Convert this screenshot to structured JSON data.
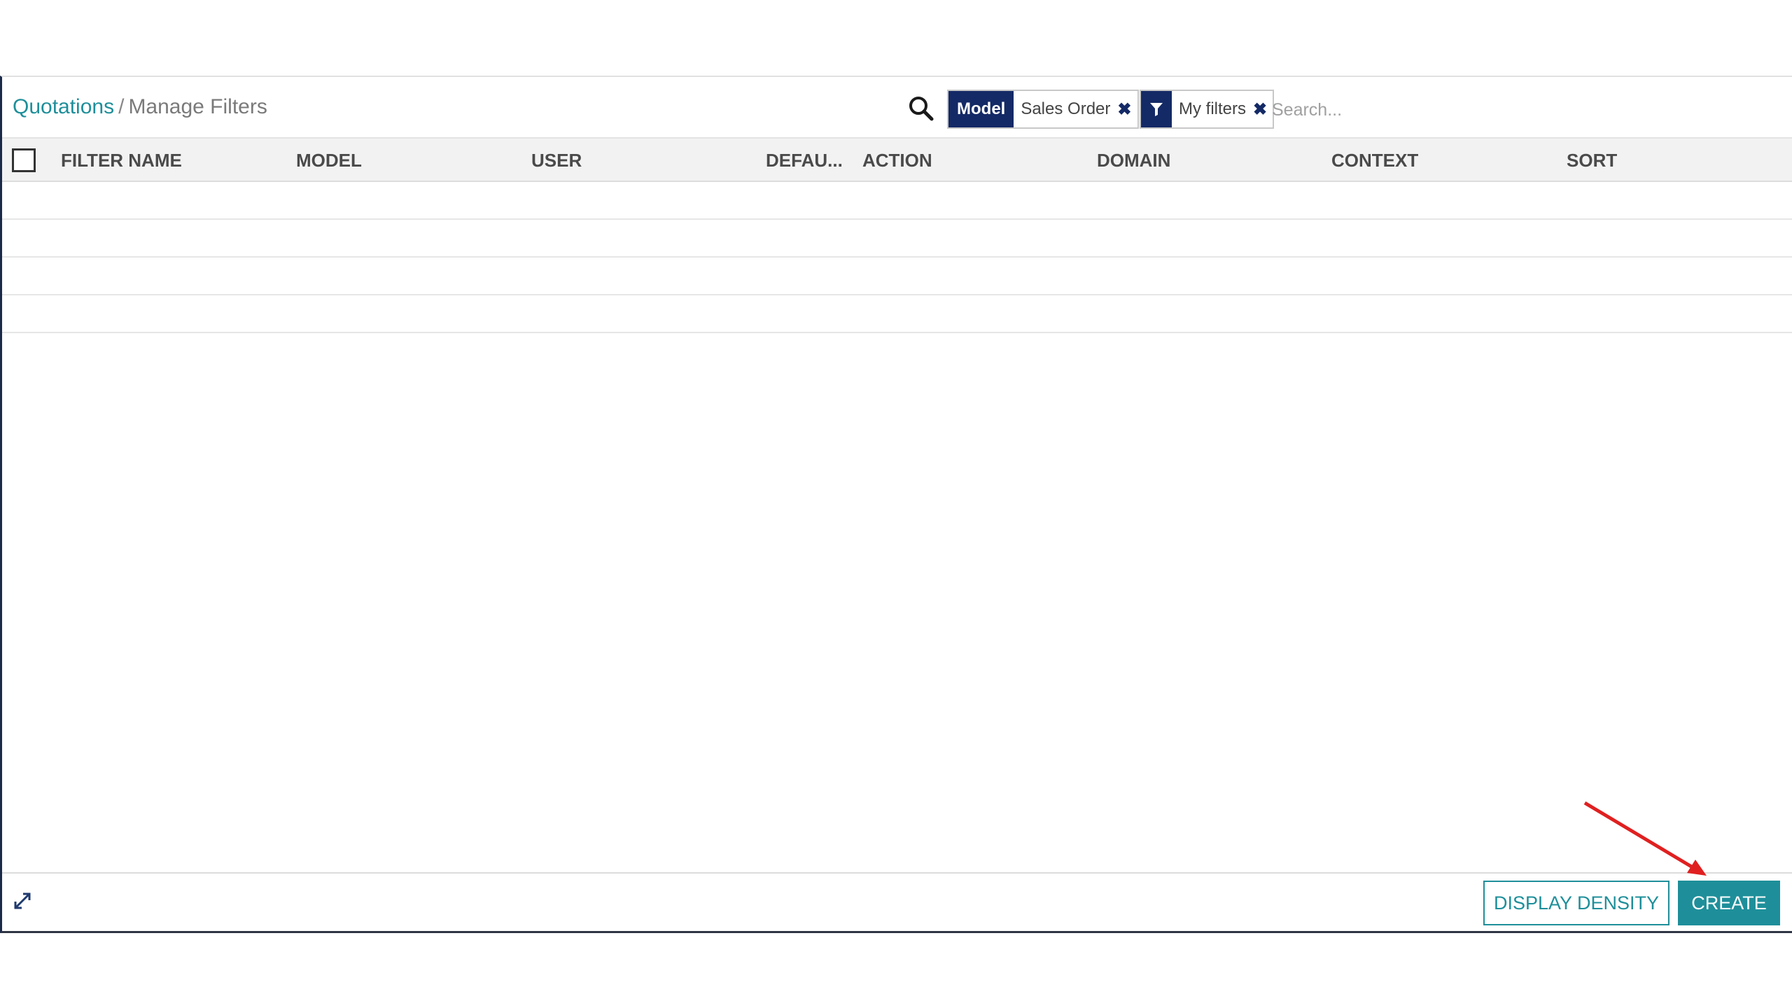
{
  "breadcrumb": {
    "parent": "Quotations",
    "separator": "/",
    "current": "Manage Filters"
  },
  "search": {
    "placeholder": "Search...",
    "facets": [
      {
        "label": "Model",
        "value": "Sales Order",
        "remove_icon": "close-icon"
      },
      {
        "icon": "filter-icon",
        "value": "My filters",
        "remove_icon": "close-icon"
      }
    ]
  },
  "table": {
    "columns": [
      "FILTER NAME",
      "MODEL",
      "USER",
      "DEFAU...",
      "ACTION",
      "DOMAIN",
      "CONTEXT",
      "SORT"
    ],
    "rows": []
  },
  "footer": {
    "expand_icon": "expand-icon",
    "display_density_label": "DISPLAY DENSITY",
    "create_label": "CREATE"
  },
  "colors": {
    "accent": "#1e8f9a",
    "facet_dark": "#142a66",
    "annotation": "#e02020"
  }
}
